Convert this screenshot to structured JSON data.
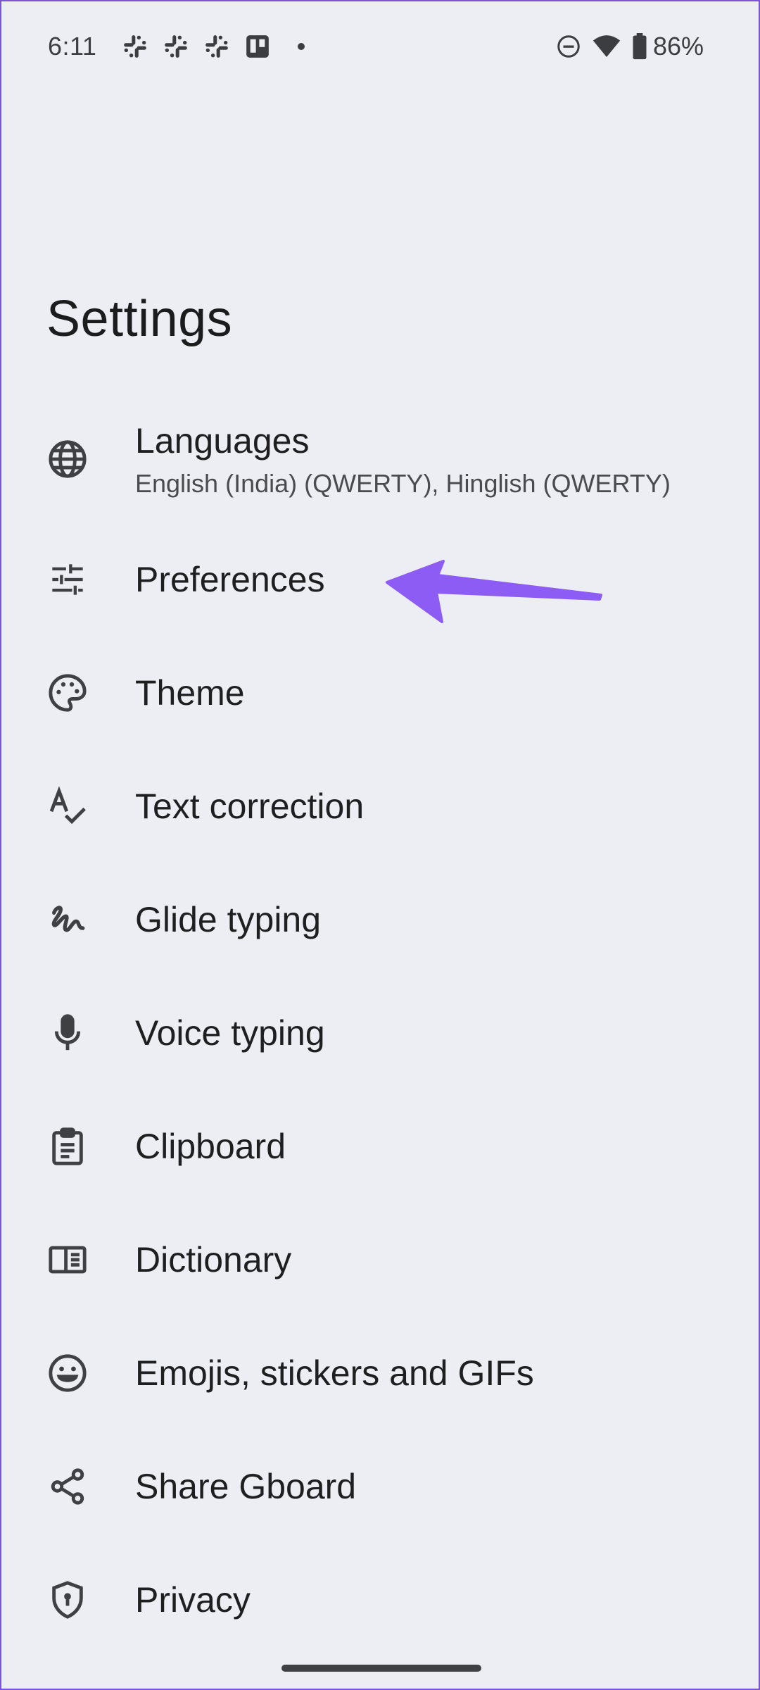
{
  "status_bar": {
    "time": "6:11",
    "notification_icons": [
      "slack-icon",
      "slack-icon",
      "slack-icon",
      "trello-icon"
    ],
    "battery_percent": "86%",
    "icons": [
      "dnd-icon",
      "wifi-icon",
      "battery-icon"
    ]
  },
  "page": {
    "title": "Settings"
  },
  "items": [
    {
      "label": "Languages",
      "sublabel": "English (India) (QWERTY), Hinglish (QWERTY)",
      "icon": "globe-icon"
    },
    {
      "label": "Preferences",
      "icon": "tune-icon"
    },
    {
      "label": "Theme",
      "icon": "palette-icon"
    },
    {
      "label": "Text correction",
      "icon": "spellcheck-icon"
    },
    {
      "label": "Glide typing",
      "icon": "gesture-icon"
    },
    {
      "label": "Voice typing",
      "icon": "mic-icon"
    },
    {
      "label": "Clipboard",
      "icon": "clipboard-icon"
    },
    {
      "label": "Dictionary",
      "icon": "dictionary-icon"
    },
    {
      "label": "Emojis, stickers and GIFs",
      "icon": "emoji-icon"
    },
    {
      "label": "Share Gboard",
      "icon": "share-icon"
    },
    {
      "label": "Privacy",
      "icon": "privacy-icon"
    }
  ],
  "colors": {
    "background": "#eceef3",
    "annotation_arrow": "#8c5cf5",
    "icon": "#3f4044"
  }
}
